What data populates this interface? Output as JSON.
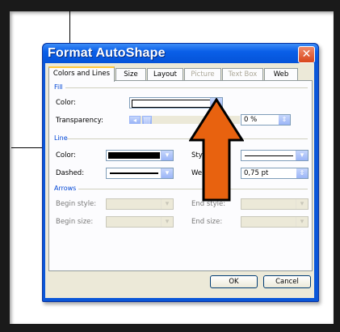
{
  "dialog": {
    "title": "Format AutoShape",
    "close_icon": "close-icon"
  },
  "tabs": [
    {
      "label": "Colors and Lines",
      "active": true,
      "enabled": true
    },
    {
      "label": "Size",
      "enabled": true
    },
    {
      "label": "Layout",
      "enabled": true
    },
    {
      "label": "Picture",
      "enabled": false
    },
    {
      "label": "Text Box",
      "enabled": false
    },
    {
      "label": "Web",
      "enabled": true
    }
  ],
  "fill": {
    "group_label": "Fill",
    "color_label": "Color:",
    "transparency_label": "Transparency:",
    "transparency_value": "0 %"
  },
  "line": {
    "group_label": "Line",
    "color_label": "Color:",
    "style_label": "Style:",
    "dashed_label": "Dashed:",
    "weight_label": "Weight:",
    "weight_value": "0,75 pt"
  },
  "arrows": {
    "group_label": "Arrows",
    "begin_style_label": "Begin style:",
    "end_style_label": "End style:",
    "begin_size_label": "Begin size:",
    "end_size_label": "End size:"
  },
  "buttons": {
    "ok": "OK",
    "cancel": "Cancel"
  },
  "colors": {
    "highlight_arrow": "#e8620f",
    "title_bar": "#0a5fe8",
    "line_color_swatch": "#000000"
  }
}
